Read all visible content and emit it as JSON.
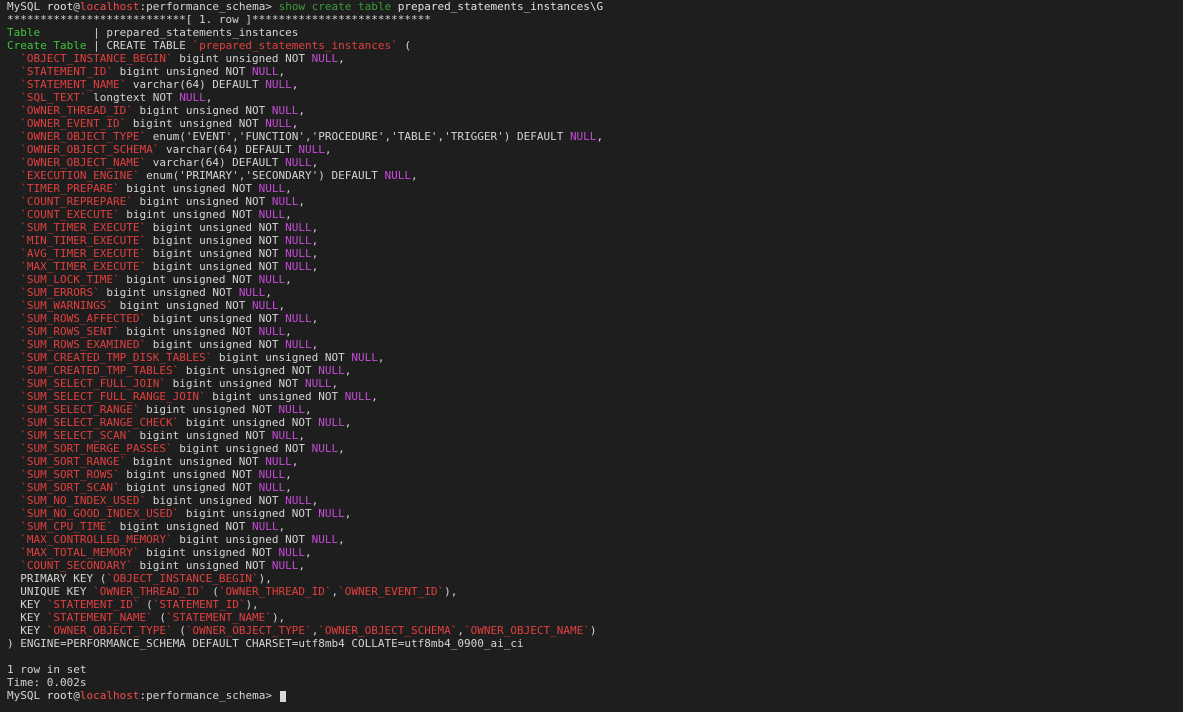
{
  "terminal": {
    "prompt": {
      "prefix": "MySQL",
      "user": "root",
      "at": "@",
      "host": "localhost",
      "separator": ":",
      "schema": "performance_schema",
      "arrow": ">"
    },
    "command": {
      "keywords": "show create table",
      "table": "prepared_statements_instances\\G"
    },
    "row_header": "***************************[ 1. row ]***************************",
    "result": {
      "table_label": "Table",
      "table_value": "prepared_statements_instances",
      "create_label": "Create Table",
      "create_prefix": "CREATE TABLE ",
      "create_name": "`prepared_statements_instances`",
      "create_suffix": " ("
    },
    "columns": [
      {
        "name": "`OBJECT_INSTANCE_BEGIN`",
        "type": " bigint unsigned NOT ",
        "null": "NULL",
        "tail": ","
      },
      {
        "name": "`STATEMENT_ID`",
        "type": " bigint unsigned NOT ",
        "null": "NULL",
        "tail": ","
      },
      {
        "name": "`STATEMENT_NAME`",
        "type": " varchar(64) DEFAULT ",
        "null": "NULL",
        "tail": ","
      },
      {
        "name": "`SQL_TEXT`",
        "type": " longtext NOT ",
        "null": "NULL",
        "tail": ","
      },
      {
        "name": "`OWNER_THREAD_ID`",
        "type": " bigint unsigned NOT ",
        "null": "NULL",
        "tail": ","
      },
      {
        "name": "`OWNER_EVENT_ID`",
        "type": " bigint unsigned NOT ",
        "null": "NULL",
        "tail": ","
      },
      {
        "name": "`OWNER_OBJECT_TYPE`",
        "type": " enum('EVENT','FUNCTION','PROCEDURE','TABLE','TRIGGER') DEFAULT ",
        "null": "NULL",
        "tail": ","
      },
      {
        "name": "`OWNER_OBJECT_SCHEMA`",
        "type": " varchar(64) DEFAULT ",
        "null": "NULL",
        "tail": ","
      },
      {
        "name": "`OWNER_OBJECT_NAME`",
        "type": " varchar(64) DEFAULT ",
        "null": "NULL",
        "tail": ","
      },
      {
        "name": "`EXECUTION_ENGINE`",
        "type": " enum('PRIMARY','SECONDARY') DEFAULT ",
        "null": "NULL",
        "tail": ","
      },
      {
        "name": "`TIMER_PREPARE`",
        "type": " bigint unsigned NOT ",
        "null": "NULL",
        "tail": ","
      },
      {
        "name": "`COUNT_REPREPARE`",
        "type": " bigint unsigned NOT ",
        "null": "NULL",
        "tail": ","
      },
      {
        "name": "`COUNT_EXECUTE`",
        "type": " bigint unsigned NOT ",
        "null": "NULL",
        "tail": ","
      },
      {
        "name": "`SUM_TIMER_EXECUTE`",
        "type": " bigint unsigned NOT ",
        "null": "NULL",
        "tail": ","
      },
      {
        "name": "`MIN_TIMER_EXECUTE`",
        "type": " bigint unsigned NOT ",
        "null": "NULL",
        "tail": ","
      },
      {
        "name": "`AVG_TIMER_EXECUTE`",
        "type": " bigint unsigned NOT ",
        "null": "NULL",
        "tail": ","
      },
      {
        "name": "`MAX_TIMER_EXECUTE`",
        "type": " bigint unsigned NOT ",
        "null": "NULL",
        "tail": ","
      },
      {
        "name": "`SUM_LOCK_TIME`",
        "type": " bigint unsigned NOT ",
        "null": "NULL",
        "tail": ","
      },
      {
        "name": "`SUM_ERRORS`",
        "type": " bigint unsigned NOT ",
        "null": "NULL",
        "tail": ","
      },
      {
        "name": "`SUM_WARNINGS`",
        "type": " bigint unsigned NOT ",
        "null": "NULL",
        "tail": ","
      },
      {
        "name": "`SUM_ROWS_AFFECTED`",
        "type": " bigint unsigned NOT ",
        "null": "NULL",
        "tail": ","
      },
      {
        "name": "`SUM_ROWS_SENT`",
        "type": " bigint unsigned NOT ",
        "null": "NULL",
        "tail": ","
      },
      {
        "name": "`SUM_ROWS_EXAMINED`",
        "type": " bigint unsigned NOT ",
        "null": "NULL",
        "tail": ","
      },
      {
        "name": "`SUM_CREATED_TMP_DISK_TABLES`",
        "type": " bigint unsigned NOT ",
        "null": "NULL",
        "tail": ","
      },
      {
        "name": "`SUM_CREATED_TMP_TABLES`",
        "type": " bigint unsigned NOT ",
        "null": "NULL",
        "tail": ","
      },
      {
        "name": "`SUM_SELECT_FULL_JOIN`",
        "type": " bigint unsigned NOT ",
        "null": "NULL",
        "tail": ","
      },
      {
        "name": "`SUM_SELECT_FULL_RANGE_JOIN`",
        "type": " bigint unsigned NOT ",
        "null": "NULL",
        "tail": ","
      },
      {
        "name": "`SUM_SELECT_RANGE`",
        "type": " bigint unsigned NOT ",
        "null": "NULL",
        "tail": ","
      },
      {
        "name": "`SUM_SELECT_RANGE_CHECK`",
        "type": " bigint unsigned NOT ",
        "null": "NULL",
        "tail": ","
      },
      {
        "name": "`SUM_SELECT_SCAN`",
        "type": " bigint unsigned NOT ",
        "null": "NULL",
        "tail": ","
      },
      {
        "name": "`SUM_SORT_MERGE_PASSES`",
        "type": " bigint unsigned NOT ",
        "null": "NULL",
        "tail": ","
      },
      {
        "name": "`SUM_SORT_RANGE`",
        "type": " bigint unsigned NOT ",
        "null": "NULL",
        "tail": ","
      },
      {
        "name": "`SUM_SORT_ROWS`",
        "type": " bigint unsigned NOT ",
        "null": "NULL",
        "tail": ","
      },
      {
        "name": "`SUM_SORT_SCAN`",
        "type": " bigint unsigned NOT ",
        "null": "NULL",
        "tail": ","
      },
      {
        "name": "`SUM_NO_INDEX_USED`",
        "type": " bigint unsigned NOT ",
        "null": "NULL",
        "tail": ","
      },
      {
        "name": "`SUM_NO_GOOD_INDEX_USED`",
        "type": " bigint unsigned NOT ",
        "null": "NULL",
        "tail": ","
      },
      {
        "name": "`SUM_CPU_TIME`",
        "type": " bigint unsigned NOT ",
        "null": "NULL",
        "tail": ","
      },
      {
        "name": "`MAX_CONTROLLED_MEMORY`",
        "type": " bigint unsigned NOT ",
        "null": "NULL",
        "tail": ","
      },
      {
        "name": "`MAX_TOTAL_MEMORY`",
        "type": " bigint unsigned NOT ",
        "null": "NULL",
        "tail": ","
      },
      {
        "name": "`COUNT_SECONDARY`",
        "type": " bigint unsigned NOT ",
        "null": "NULL",
        "tail": ","
      }
    ],
    "keys": [
      {
        "parts": [
          [
            "plain",
            "  PRIMARY KEY ("
          ],
          [
            "ident",
            "`OBJECT_INSTANCE_BEGIN`"
          ],
          [
            "plain",
            "),"
          ]
        ]
      },
      {
        "parts": [
          [
            "plain",
            "  UNIQUE KEY "
          ],
          [
            "ident",
            "`OWNER_THREAD_ID`"
          ],
          [
            "plain",
            " ("
          ],
          [
            "ident",
            "`OWNER_THREAD_ID`"
          ],
          [
            "plain",
            ","
          ],
          [
            "ident",
            "`OWNER_EVENT_ID`"
          ],
          [
            "plain",
            "),"
          ]
        ]
      },
      {
        "parts": [
          [
            "plain",
            "  KEY "
          ],
          [
            "ident",
            "`STATEMENT_ID`"
          ],
          [
            "plain",
            " ("
          ],
          [
            "ident",
            "`STATEMENT_ID`"
          ],
          [
            "plain",
            "),"
          ]
        ]
      },
      {
        "parts": [
          [
            "plain",
            "  KEY "
          ],
          [
            "ident",
            "`STATEMENT_NAME`"
          ],
          [
            "plain",
            " ("
          ],
          [
            "ident",
            "`STATEMENT_NAME`"
          ],
          [
            "plain",
            "),"
          ]
        ]
      },
      {
        "parts": [
          [
            "plain",
            "  KEY "
          ],
          [
            "ident",
            "`OWNER_OBJECT_TYPE`"
          ],
          [
            "plain",
            " ("
          ],
          [
            "ident",
            "`OWNER_OBJECT_TYPE`"
          ],
          [
            "plain",
            ","
          ],
          [
            "ident",
            "`OWNER_OBJECT_SCHEMA`"
          ],
          [
            "plain",
            ","
          ],
          [
            "ident",
            "`OWNER_OBJECT_NAME`"
          ],
          [
            "plain",
            ")"
          ]
        ]
      }
    ],
    "engine_line": ") ENGINE=PERFORMANCE_SCHEMA DEFAULT CHARSET=utf8mb4 COLLATE=utf8mb4_0900_ai_ci",
    "rows_in_set": "1 row in set",
    "time": "Time: 0.002s"
  },
  "colors": {
    "background": "#1e1e1e",
    "text": "#d4d4d4",
    "host": "#f24a4a",
    "command": "#3a9b3a",
    "label": "#3fc23f",
    "identifier": "#e23f3f",
    "null_keyword": "#c54bd7"
  }
}
